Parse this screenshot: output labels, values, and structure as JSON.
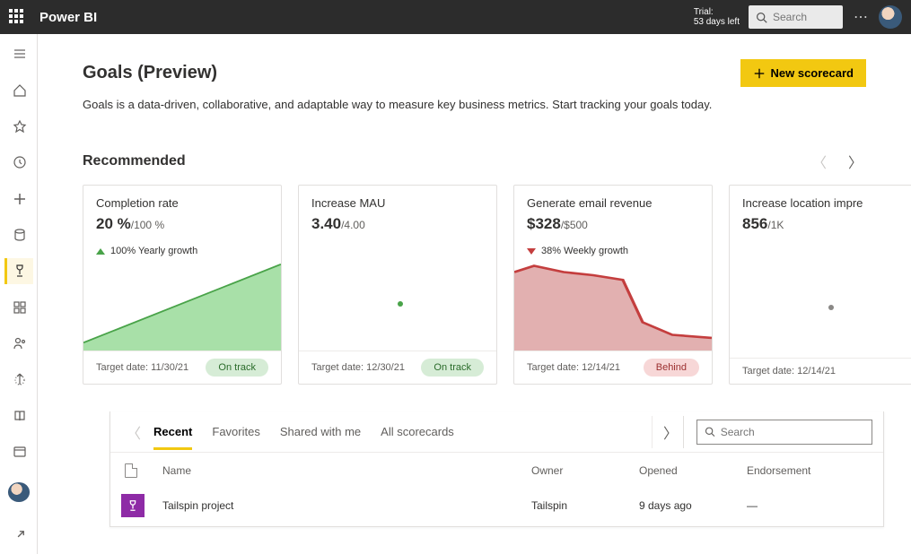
{
  "header": {
    "app_title": "Power BI",
    "trial_line1": "Trial:",
    "trial_line2": "53 days left",
    "search_placeholder": "Search"
  },
  "page": {
    "title": "Goals (Preview)",
    "subtitle": "Goals is a data-driven, collaborative, and adaptable way to measure key business metrics. Start tracking your goals today.",
    "new_scorecard_label": "New scorecard",
    "recommended_heading": "Recommended"
  },
  "cards": [
    {
      "title": "Completion rate",
      "value": "20 %",
      "denom": "/100 %",
      "growth_dir": "up",
      "growth_text": "100% Yearly growth",
      "target_label": "Target date: 11/30/21",
      "status": "On track",
      "status_class": "pill-ontrack",
      "spark_type": "area-green"
    },
    {
      "title": "Increase MAU",
      "value": "3.40",
      "denom": "/4.00",
      "growth_dir": "",
      "growth_text": "",
      "target_label": "Target date: 12/30/21",
      "status": "On track",
      "status_class": "pill-ontrack",
      "spark_type": "dot-green"
    },
    {
      "title": "Generate email revenue",
      "value": "$328",
      "denom": "/$500",
      "growth_dir": "down",
      "growth_text": "38% Weekly growth",
      "target_label": "Target date: 12/14/21",
      "status": "Behind",
      "status_class": "pill-behind",
      "spark_type": "area-red"
    },
    {
      "title": "Increase location impre",
      "value": "856",
      "denom": "/1K",
      "growth_dir": "",
      "growth_text": "",
      "target_label": "Target date: 12/14/21",
      "status": "",
      "status_class": "",
      "spark_type": "dot-grey"
    }
  ],
  "tabs": {
    "items": [
      "Recent",
      "Favorites",
      "Shared with me",
      "All scorecards"
    ],
    "active_index": 0,
    "search_placeholder": "Search"
  },
  "table": {
    "headers": {
      "name": "Name",
      "owner": "Owner",
      "opened": "Opened",
      "endorsement": "Endorsement"
    },
    "rows": [
      {
        "name": "Tailspin project",
        "owner": "Tailspin",
        "opened": "9 days ago",
        "endorsement": "—"
      }
    ]
  },
  "nav": {
    "items": [
      "menu",
      "home",
      "favorites",
      "recent",
      "create",
      "datasets",
      "goals",
      "apps",
      "deployment",
      "learn",
      "workspaces",
      "browse"
    ]
  }
}
